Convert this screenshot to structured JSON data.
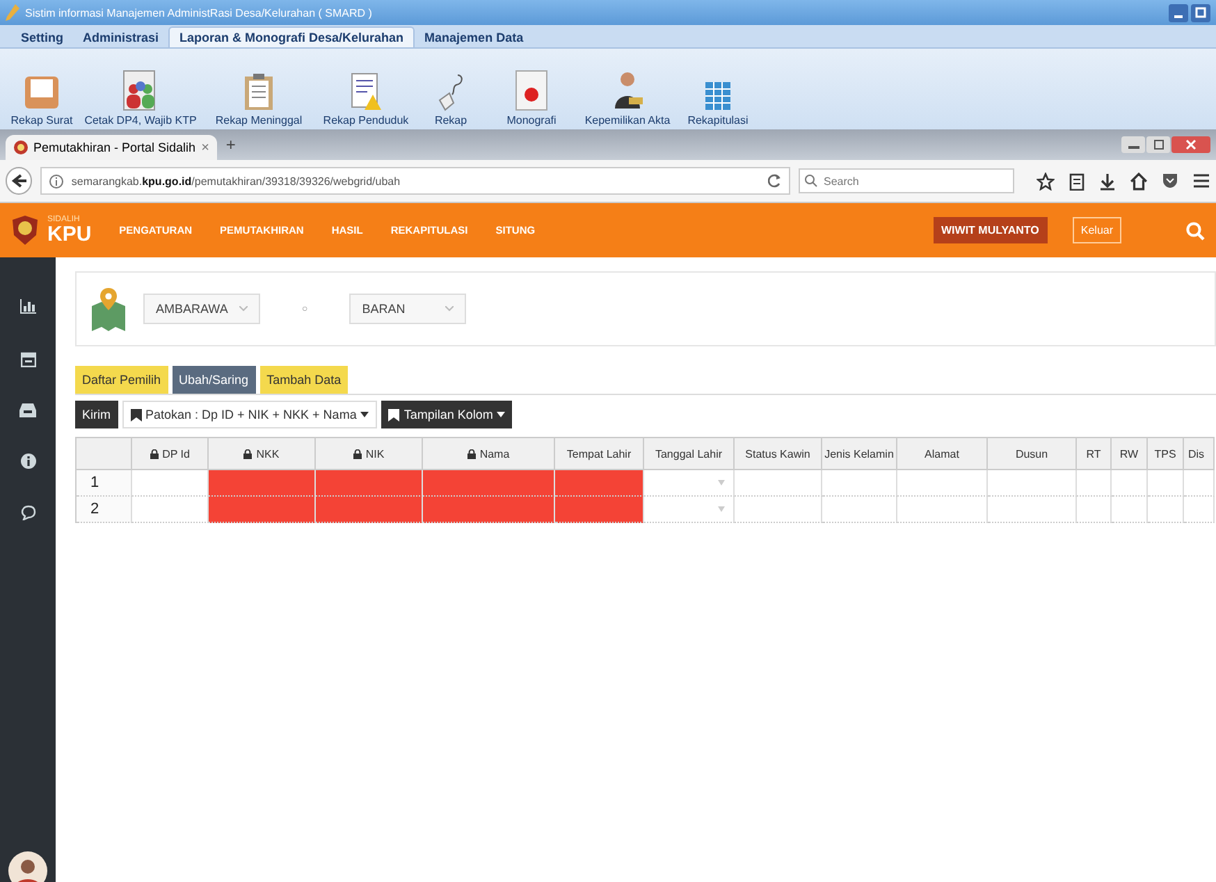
{
  "app_window": {
    "title": "Sistim informasi Manajemen AdministRasi Desa/Kelurahan ( SMARD )"
  },
  "ribbon_tabs": [
    {
      "label": "Setting",
      "selected": false
    },
    {
      "label": "Administrasi",
      "selected": false
    },
    {
      "label": "Laporan & Monografi Desa/Kelurahan",
      "selected": true
    },
    {
      "label": "Manajemen Data",
      "selected": false
    }
  ],
  "ribbon_items": [
    {
      "label": "Rekap Surat",
      "kind": "tray"
    },
    {
      "label": "Cetak DP4, Wajib KTP",
      "kind": "people"
    },
    {
      "label": "Rekap Meninggal",
      "kind": "clipboard"
    },
    {
      "label": "Rekap Penduduk",
      "kind": "report"
    },
    {
      "label": "Rekap",
      "kind": "hand"
    },
    {
      "label": "Monografi",
      "kind": "pie"
    },
    {
      "label": "Kepemilikan Akta",
      "kind": "person"
    },
    {
      "label": "Rekapitulasi",
      "kind": "grid"
    }
  ],
  "browser": {
    "tab": "Pemutakhiran - Portal Sidalih",
    "tab_close": "×",
    "new_tab": "+",
    "url_host": "semarangkab.",
    "url_domain": "kpu.go.id",
    "url_path": "/pemutakhiran/39318/39326/webgrid/ubah",
    "search_placeholder": "Search"
  },
  "site_nav": {
    "logo_top": "SIDALIH",
    "logo": "KPU",
    "items": [
      "PENGATURAN",
      "PEMUTAKHIRAN",
      "HASIL",
      "REKAPITULASI",
      "SITUNG"
    ],
    "user": "WIWIT MULYANTO",
    "logout": "Keluar"
  },
  "location": {
    "district": "AMBARAWA",
    "separator": "○",
    "village": "BARAN"
  },
  "tabs": [
    {
      "label": "Daftar Pemilih",
      "selected": false
    },
    {
      "label": "Ubah/Saring",
      "selected": true
    },
    {
      "label": "Tambah Data",
      "selected": false
    }
  ],
  "toolbar": {
    "submit": "Kirim",
    "key_dropdown": "Patokan : Dp ID + NIK + NKK + Nama",
    "columns_dropdown": "Tampilan Kolom"
  },
  "table": {
    "columns": [
      {
        "label": "DP Id",
        "locked": true
      },
      {
        "label": "NKK",
        "locked": true
      },
      {
        "label": "NIK",
        "locked": true
      },
      {
        "label": "Nama",
        "locked": true
      },
      {
        "label": "Tempat Lahir",
        "locked": false
      },
      {
        "label": "Tanggal Lahir",
        "locked": false
      },
      {
        "label": "Status Kawin",
        "locked": false
      },
      {
        "label": "Jenis Kelamin",
        "locked": false
      },
      {
        "label": "Alamat",
        "locked": false
      },
      {
        "label": "Dusun",
        "locked": false
      },
      {
        "label": "RT",
        "locked": false
      },
      {
        "label": "RW",
        "locked": false
      },
      {
        "label": "TPS",
        "locked": false
      },
      {
        "label": "Dis",
        "locked": false
      }
    ],
    "rows": [
      {
        "number": "1",
        "cells": [
          {
            "kind": "text",
            "invalid": false
          },
          {
            "kind": "text",
            "invalid": true
          },
          {
            "kind": "text",
            "invalid": true
          },
          {
            "kind": "text",
            "invalid": true
          },
          {
            "kind": "text",
            "invalid": true
          },
          {
            "kind": "dropdown",
            "invalid": false
          },
          {
            "kind": "text",
            "invalid": false
          },
          {
            "kind": "text",
            "invalid": false
          },
          {
            "kind": "text",
            "invalid": false
          },
          {
            "kind": "text",
            "invalid": false
          },
          {
            "kind": "text",
            "invalid": false
          },
          {
            "kind": "text",
            "invalid": false
          },
          {
            "kind": "text",
            "invalid": false
          },
          {
            "kind": "text",
            "invalid": false
          }
        ]
      },
      {
        "number": "2",
        "cells": [
          {
            "kind": "text",
            "invalid": false
          },
          {
            "kind": "text",
            "invalid": true
          },
          {
            "kind": "text",
            "invalid": true
          },
          {
            "kind": "text",
            "invalid": true
          },
          {
            "kind": "text",
            "invalid": true
          },
          {
            "kind": "dropdown",
            "invalid": false
          },
          {
            "kind": "text",
            "invalid": false
          },
          {
            "kind": "text",
            "invalid": false
          },
          {
            "kind": "text",
            "invalid": false
          },
          {
            "kind": "text",
            "invalid": false
          },
          {
            "kind": "text",
            "invalid": false
          },
          {
            "kind": "text",
            "invalid": false
          },
          {
            "kind": "text",
            "invalid": false
          },
          {
            "kind": "text",
            "invalid": false
          }
        ]
      }
    ]
  }
}
